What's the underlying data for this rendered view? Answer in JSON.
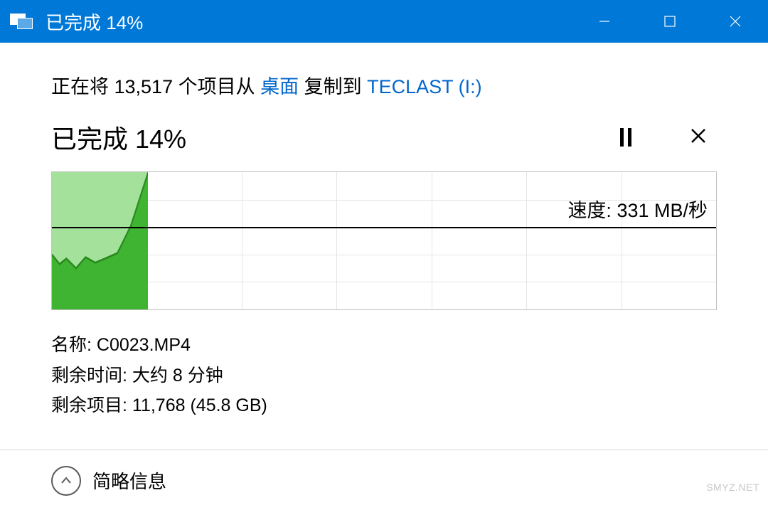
{
  "titlebar": {
    "title": "已完成 14%"
  },
  "main": {
    "copy_prefix": "正在将 13,517 个项目从 ",
    "copy_source": "桌面",
    "copy_mid": " 复制到 ",
    "copy_dest": "TECLAST (I:)",
    "progress_text": "已完成 14%",
    "speed_label": "速度: 331 MB/秒"
  },
  "details": {
    "name_label": "名称: ",
    "name_value": "C0023.MP4",
    "time_label": "剩余时间: ",
    "time_value": "大约 8 分钟",
    "items_label": "剩余项目: ",
    "items_value": "11,768 (45.8 GB)"
  },
  "footer": {
    "label": "简略信息"
  },
  "watermark": "SMYZ.NET",
  "chart_data": {
    "type": "area",
    "title": "",
    "xlabel": "",
    "ylabel": "速度",
    "ylim": [
      0,
      550
    ],
    "reference_line": 331,
    "series": [
      {
        "name": "transfer_speed_mb_per_sec",
        "values": [
          220,
          180,
          200,
          170,
          210,
          190,
          200,
          230,
          340,
          550
        ]
      }
    ],
    "progress_fraction": 0.145
  }
}
